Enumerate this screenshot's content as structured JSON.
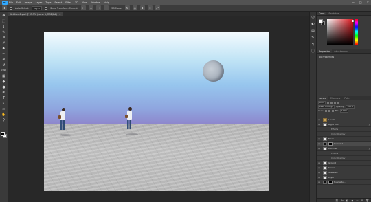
{
  "app": {
    "logo": "Ps"
  },
  "menu": [
    "File",
    "Edit",
    "Image",
    "Layer",
    "Type",
    "Select",
    "Filter",
    "3D",
    "View",
    "Window",
    "Help"
  ],
  "window_controls": [
    "—",
    "□",
    "✕"
  ],
  "options_bar": {
    "auto_select_label": "Auto-Select:",
    "auto_select_value": "Layer",
    "transform_label": "Show Transform Controls",
    "mode_label": "3D Mode:"
  },
  "document_tab": {
    "title": "Untitled-1.psd @ 33.3% (Layer 1, RGB/8#)",
    "close": "×"
  },
  "toolbar": {
    "tools": [
      "move-tool",
      "marquee-tool",
      "lasso-tool",
      "quick-select-tool",
      "crop-tool",
      "eyedropper-tool",
      "healing-tool",
      "brush-tool",
      "clone-stamp-tool",
      "history-brush-tool",
      "eraser-tool",
      "gradient-tool",
      "blur-tool",
      "dodge-tool",
      "pen-tool",
      "type-tool",
      "path-select-tool",
      "rectangle-tool",
      "hand-tool",
      "zoom-tool",
      "more-tools"
    ],
    "glyphs": [
      "✥",
      "⬚",
      "ʆ",
      "✎",
      "⌗",
      "✐",
      "✚",
      "✏",
      "⊕",
      "↺",
      "⌫",
      "▦",
      "◆",
      "●",
      "✒",
      "T",
      "↖",
      "▭",
      "✋",
      "⚲",
      "…"
    ],
    "foreground": "#000000",
    "background": "#ffffff"
  },
  "right_strip_icons": [
    "history-icon",
    "adjust-icon",
    "swatch-icon",
    "brush-settings-icon",
    "paragraph-icon",
    "info-icon"
  ],
  "right_strip_glyphs": [
    "◷",
    "◐",
    "▤",
    "✎",
    "¶",
    "ⓘ"
  ],
  "color_panel": {
    "tabs": [
      "Color",
      "Swatches"
    ],
    "hue_color": "#e3141b"
  },
  "properties_panel": {
    "tabs": [
      "Properties",
      "Adjustments"
    ],
    "body": "No Properties"
  },
  "layers_panel": {
    "tabs": [
      "Layers",
      "Channels",
      "Paths"
    ],
    "filter_label": "Kind",
    "blend_mode": "Pass Through",
    "opacity_label": "Opacity:",
    "opacity_value": "100%",
    "lock_label": "Lock:",
    "fill_label": "Fill:",
    "fill_value": "100%",
    "layers": [
      {
        "name": "Levels",
        "type": "folder"
      },
      {
        "name": "Right men",
        "type": "layer",
        "fx": true
      },
      {
        "name": "Effects",
        "type": "sub"
      },
      {
        "name": "Color Overlay",
        "type": "sub"
      },
      {
        "name": "Moon",
        "type": "layer"
      },
      {
        "name": "Curves 1",
        "type": "adjust",
        "selected": true
      },
      {
        "name": "Left men",
        "type": "layer",
        "fx": true
      },
      {
        "name": "Effects",
        "type": "sub"
      },
      {
        "name": "Color Overlay",
        "type": "sub"
      },
      {
        "name": "Ground",
        "type": "layer"
      },
      {
        "name": "Stroke",
        "type": "layer"
      },
      {
        "name": "Shadows",
        "type": "layer"
      },
      {
        "name": "Layer",
        "type": "layer"
      },
      {
        "name": "Hue/Satu...",
        "type": "adjust"
      }
    ],
    "footer_icons": [
      "⛓",
      "fx",
      "◧",
      "◑",
      "▭",
      "⊞",
      "🗑"
    ]
  }
}
